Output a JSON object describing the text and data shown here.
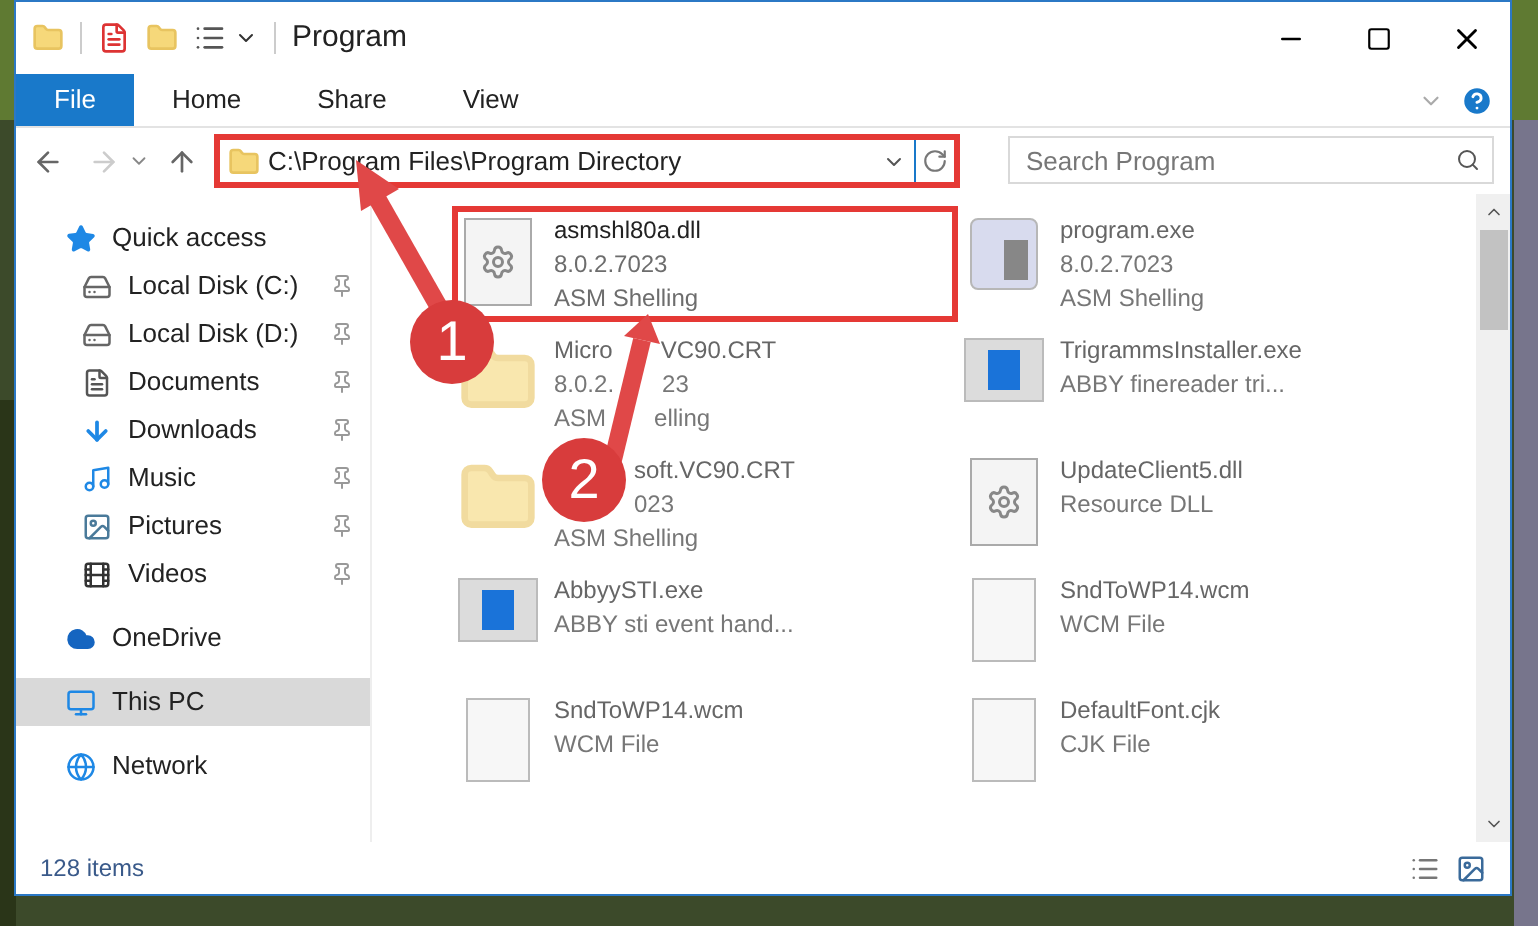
{
  "window": {
    "title": "Program"
  },
  "ribbon_tabs": [
    {
      "label": "File",
      "selected": true
    },
    {
      "label": "Home",
      "selected": false
    },
    {
      "label": "Share",
      "selected": false
    },
    {
      "label": "View",
      "selected": false
    }
  ],
  "address_bar": {
    "path": "C:\\Program Files\\Program Directory",
    "highlighted": true
  },
  "search": {
    "placeholder": "Search Program"
  },
  "sidebar": {
    "items": [
      {
        "label": "Quick access",
        "kind": "quick",
        "selected": false,
        "children": [
          {
            "label": "Local Disk (C:)",
            "kind": "disk",
            "pinned": true
          },
          {
            "label": "Local Disk (D:)",
            "kind": "disk",
            "pinned": true
          },
          {
            "label": "Documents",
            "kind": "documents",
            "pinned": true
          },
          {
            "label": "Downloads",
            "kind": "downloads",
            "pinned": true
          },
          {
            "label": "Music",
            "kind": "music",
            "pinned": true
          },
          {
            "label": "Pictures",
            "kind": "pictures",
            "pinned": true
          },
          {
            "label": "Videos",
            "kind": "videos",
            "pinned": true
          }
        ]
      },
      {
        "label": "OneDrive",
        "kind": "cloud",
        "selected": false
      },
      {
        "label": "This PC",
        "kind": "pc",
        "selected": true
      },
      {
        "label": "Network",
        "kind": "network",
        "selected": false
      }
    ]
  },
  "files": [
    {
      "name": "asmshl80a.dll",
      "details": [
        "8.0.2.7023",
        "ASM Shelling"
      ],
      "kind": "dll",
      "highlighted": true,
      "faded": false
    },
    {
      "name": "program.exe",
      "details": [
        "8.0.2.7023",
        "ASM Shelling"
      ],
      "kind": "exe",
      "highlighted": false,
      "faded": true
    },
    {
      "name": [
        "Micro",
        "VC90.CRT"
      ],
      "details": [
        [
          "8.0.2.",
          "23"
        ],
        [
          "ASM",
          "elling"
        ]
      ],
      "kind": "folder",
      "highlighted": false,
      "faded": true
    },
    {
      "name": "TrigrammsInstaller.exe",
      "details": [
        "ABBY finereader tri..."
      ],
      "kind": "app",
      "highlighted": false,
      "faded": true
    },
    {
      "name": {
        "text": "soft.VC90.CRT",
        "covered": true
      },
      "details": [
        {
          "text": "023",
          "covered": true
        },
        "ASM Shelling"
      ],
      "kind": "folder",
      "highlighted": false,
      "faded": true
    },
    {
      "name": "UpdateClient5.dll",
      "details": [
        "Resource DLL"
      ],
      "kind": "dll",
      "highlighted": false,
      "faded": true
    },
    {
      "name": "AbbyySTI.exe",
      "details": [
        "ABBY sti event hand..."
      ],
      "kind": "app",
      "highlighted": false,
      "faded": true
    },
    {
      "name": "SndToWP14.wcm",
      "details": [
        "WCM File"
      ],
      "kind": "blank",
      "highlighted": false,
      "faded": true
    },
    {
      "name": "SndToWP14.wcm",
      "details": [
        "WCM File"
      ],
      "kind": "blank",
      "highlighted": false,
      "faded": true
    },
    {
      "name": "DefaultFont.cjk",
      "details": [
        "CJK File"
      ],
      "kind": "blank",
      "highlighted": false,
      "faded": true
    }
  ],
  "status_bar": {
    "count": "128 items"
  },
  "callouts": [
    {
      "label": "1"
    },
    {
      "label": "2"
    }
  ]
}
